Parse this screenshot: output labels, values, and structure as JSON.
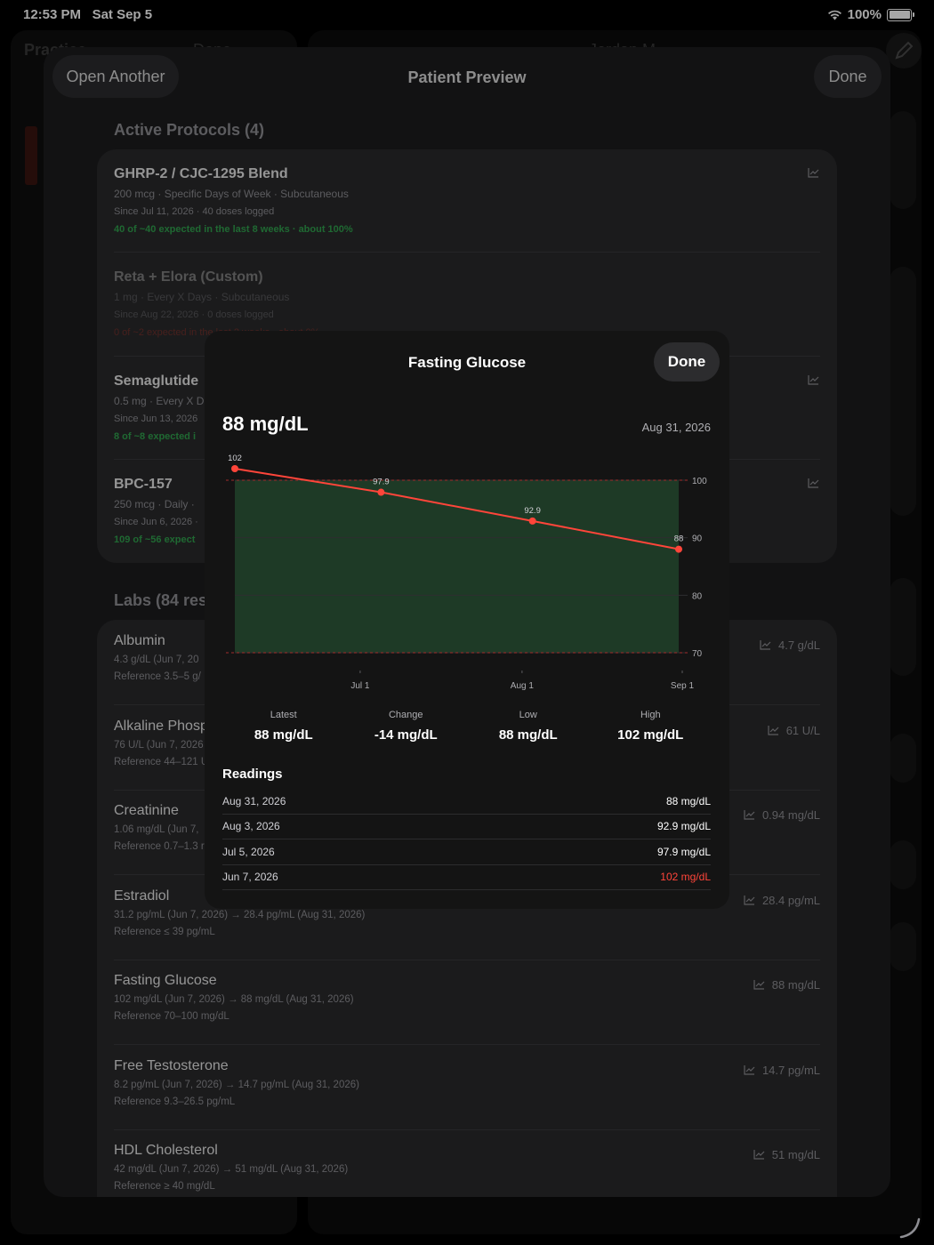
{
  "status": {
    "time": "12:53 PM",
    "date": "Sat Sep 5",
    "battery": "100%"
  },
  "background": {
    "left_title": "Practice",
    "left_action": "Done",
    "right_title": "Jordan M."
  },
  "sheet": {
    "left_button": "Open Another",
    "title": "Patient Preview",
    "right_button": "Done",
    "faded_line": "…",
    "protocols_title": "Active Protocols (4)",
    "protocols": [
      {
        "name": "GHRP-2 / CJC-1295 Blend",
        "dose": "200 mcg · Specific Days of Week · Subcutaneous",
        "since": "Since Jul 11, 2026 · 40 doses logged",
        "adherence": "40 of ~40 expected in the last 8 weeks · about 100%",
        "adherence_status": "good"
      },
      {
        "name": "Reta + Elora (Custom)",
        "dose": "1 mg · Every X Days · Subcutaneous",
        "since": "Since Aug 22, 2026 · 0 doses logged",
        "adherence": "0 of ~2 expected in the last 2 weeks · about 0%",
        "adherence_status": "bad"
      },
      {
        "name": "Semaglutide",
        "dose": "0.5 mg · Every X D",
        "since": "Since Jun 13, 2026",
        "adherence": "8 of ~8 expected i",
        "adherence_status": "good"
      },
      {
        "name": "BPC-157",
        "dose": "250 mcg · Daily ·",
        "since": "Since Jun 6, 2026 ·",
        "adherence": "109 of ~56 expect",
        "adherence_status": "good"
      }
    ],
    "labs_title": "Labs (84 res",
    "labs": [
      {
        "name": "Albumin",
        "values": "4.3 g/dL (Jun 7, 20",
        "reference": "Reference 3.5–5 g/",
        "latest": "4.7 g/dL"
      },
      {
        "name": "Alkaline Phosp",
        "values": "76 U/L (Jun 7, 2026",
        "reference": "Reference 44–121 U",
        "latest": "61 U/L"
      },
      {
        "name": "Creatinine",
        "values": "1.06 mg/dL (Jun 7,",
        "reference": "Reference 0.7–1.3 r",
        "latest": "0.94 mg/dL"
      },
      {
        "name": "Estradiol",
        "values": "31.2 pg/mL (Jun 7, 2026)  →  28.4 pg/mL (Aug 31, 2026)",
        "reference": "Reference ≤ 39 pg/mL",
        "latest": "28.4 pg/mL"
      },
      {
        "name": "Fasting Glucose",
        "values": "102 mg/dL (Jun 7, 2026)  →  88 mg/dL (Aug 31, 2026)",
        "reference": "Reference 70–100 mg/dL",
        "latest": "88 mg/dL"
      },
      {
        "name": "Free Testosterone",
        "values": "8.2 pg/mL (Jun 7, 2026)  →  14.7 pg/mL (Aug 31, 2026)",
        "reference": "Reference 9.3–26.5 pg/mL",
        "latest": "14.7 pg/mL"
      },
      {
        "name": "HDL Cholesterol",
        "values": "42 mg/dL (Jun 7, 2026)  →  51 mg/dL (Aug 31, 2026)",
        "reference": "Reference ≥ 40 mg/dL",
        "latest": "51 mg/dL"
      }
    ]
  },
  "modal": {
    "title": "Fasting Glucose",
    "done": "Done",
    "latest_value": "88 mg/dL",
    "latest_date": "Aug 31, 2026",
    "stats": [
      {
        "label": "Latest",
        "value": "88 mg/dL"
      },
      {
        "label": "Change",
        "value": "-14 mg/dL"
      },
      {
        "label": "Low",
        "value": "88 mg/dL"
      },
      {
        "label": "High",
        "value": "102 mg/dL"
      }
    ],
    "readings_title": "Readings",
    "readings": [
      {
        "date": "Aug 31, 2026",
        "value": "88 mg/dL",
        "flag": "normal"
      },
      {
        "date": "Aug 3, 2026",
        "value": "92.9 mg/dL",
        "flag": "normal"
      },
      {
        "date": "Jul 5, 2026",
        "value": "97.9 mg/dL",
        "flag": "normal"
      },
      {
        "date": "Jun 7, 2026",
        "value": "102 mg/dL",
        "flag": "high"
      }
    ]
  },
  "chart_data": {
    "type": "line",
    "title": "Fasting Glucose",
    "series": [
      {
        "name": "Fasting Glucose",
        "x": [
          "2026-06-07",
          "2026-07-05",
          "2026-08-03",
          "2026-08-31"
        ],
        "values": [
          102,
          97.9,
          92.9,
          88
        ],
        "labels": [
          "102",
          "97.9",
          "92.9",
          "88"
        ]
      }
    ],
    "x_ticks": [
      {
        "date": "2026-07-01",
        "label": "Jul 1"
      },
      {
        "date": "2026-08-01",
        "label": "Aug 1"
      },
      {
        "date": "2026-09-01",
        "label": "Sep 1"
      }
    ],
    "y_ticks": [
      70,
      80,
      90,
      100
    ],
    "ylim": [
      70,
      102
    ],
    "x_range": [
      "2026-06-07",
      "2026-08-31"
    ],
    "reference_range": [
      70,
      100
    ],
    "colors": {
      "line": "#ff453a",
      "reference_band": "#1e3a26",
      "reference_line": "#a12b2b"
    },
    "grid": true,
    "legend": "none"
  }
}
